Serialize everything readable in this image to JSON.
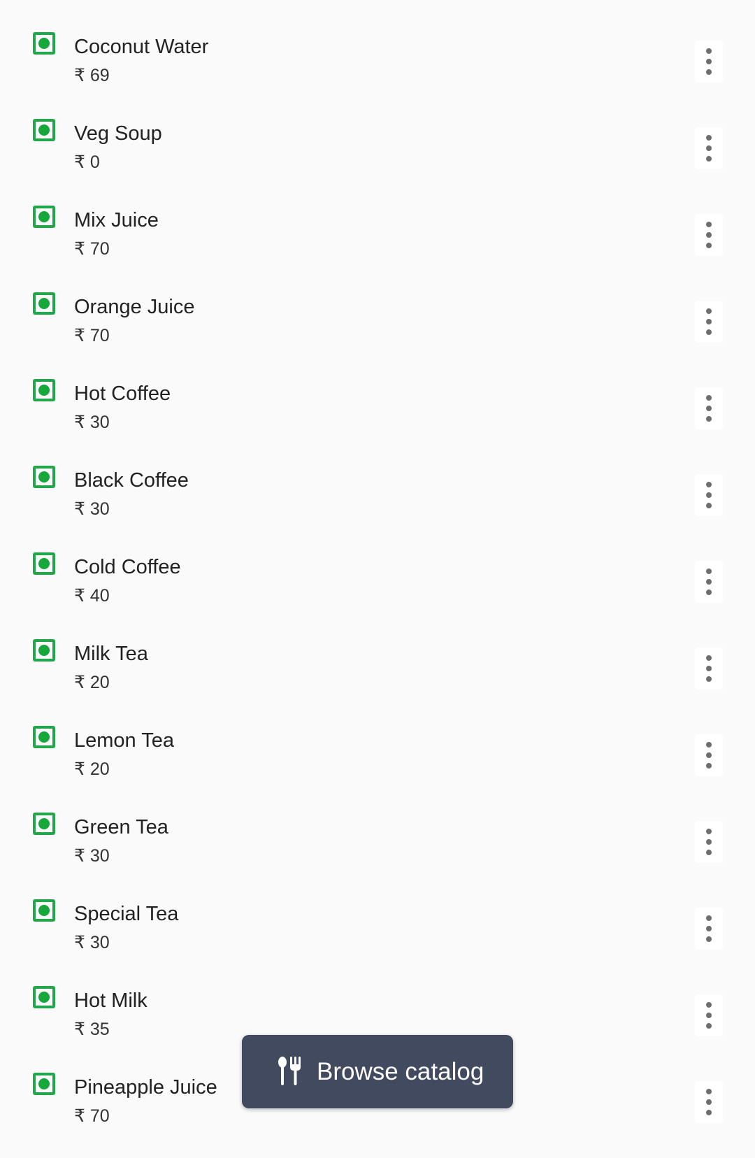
{
  "currency_symbol": "₹",
  "items": [
    {
      "name": "Coconut Water",
      "price": "₹ 69"
    },
    {
      "name": "Veg Soup",
      "price": "₹ 0"
    },
    {
      "name": "Mix Juice",
      "price": "₹ 70"
    },
    {
      "name": "Orange Juice",
      "price": "₹ 70"
    },
    {
      "name": "Hot Coffee",
      "price": "₹ 30"
    },
    {
      "name": "Black Coffee",
      "price": "₹ 30"
    },
    {
      "name": "Cold Coffee",
      "price": "₹ 40"
    },
    {
      "name": "Milk Tea",
      "price": "₹ 20"
    },
    {
      "name": "Lemon Tea",
      "price": "₹ 20"
    },
    {
      "name": "Green Tea",
      "price": "₹ 30"
    },
    {
      "name": "Special Tea",
      "price": "₹ 30"
    },
    {
      "name": "Hot Milk",
      "price": "₹ 35"
    },
    {
      "name": "Pineapple Juice",
      "price": "₹ 70"
    }
  ],
  "icons": {
    "item_type": "veg-indicator-icon",
    "item_menu": "more-vertical-icon",
    "catalog": "fork-spoon-icon"
  },
  "fab": {
    "label": "Browse catalog"
  },
  "colors": {
    "veg_green": "#16a83a",
    "fab_bg": "#424a5f",
    "background": "#fafafa"
  }
}
